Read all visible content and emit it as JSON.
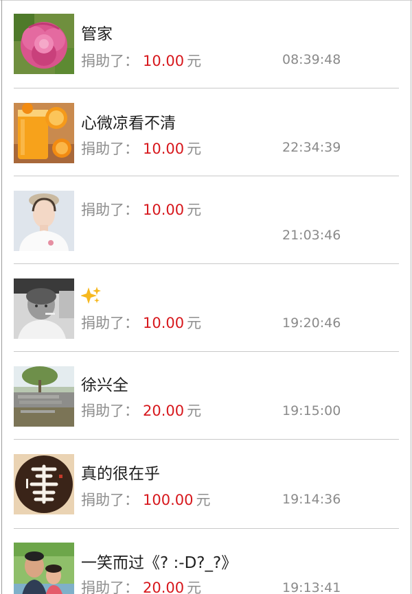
{
  "donation_label": "捐助了：",
  "currency_unit": "元",
  "donations": [
    {
      "name": "管家",
      "amount": "10.00",
      "time": "08:39:48",
      "avatar": "peony-flower"
    },
    {
      "name": "心微凉看不清",
      "amount": "10.00",
      "time": "22:34:39",
      "avatar": "orange-juice"
    },
    {
      "name": "",
      "amount": "10.00",
      "time": "21:03:46",
      "avatar": "woman-portrait"
    },
    {
      "name": "✨",
      "amount": "10.00",
      "time": "19:20:46",
      "avatar": "bw-child"
    },
    {
      "name": "徐兴全",
      "amount": "20.00",
      "time": "19:15:00",
      "avatar": "stone-slabs"
    },
    {
      "name": "真的很在乎",
      "amount": "100.00",
      "time": "19:14:36",
      "avatar": "calligraphy-shan"
    },
    {
      "name": "一笑而过《? :-D?_?》",
      "amount": "20.00",
      "time": "19:13:41",
      "avatar": "couple-photo"
    }
  ],
  "colors": {
    "amount": "#d7171c",
    "label": "#8e8e8e",
    "name": "#1f1f1f",
    "divider": "#c9c9c9"
  }
}
